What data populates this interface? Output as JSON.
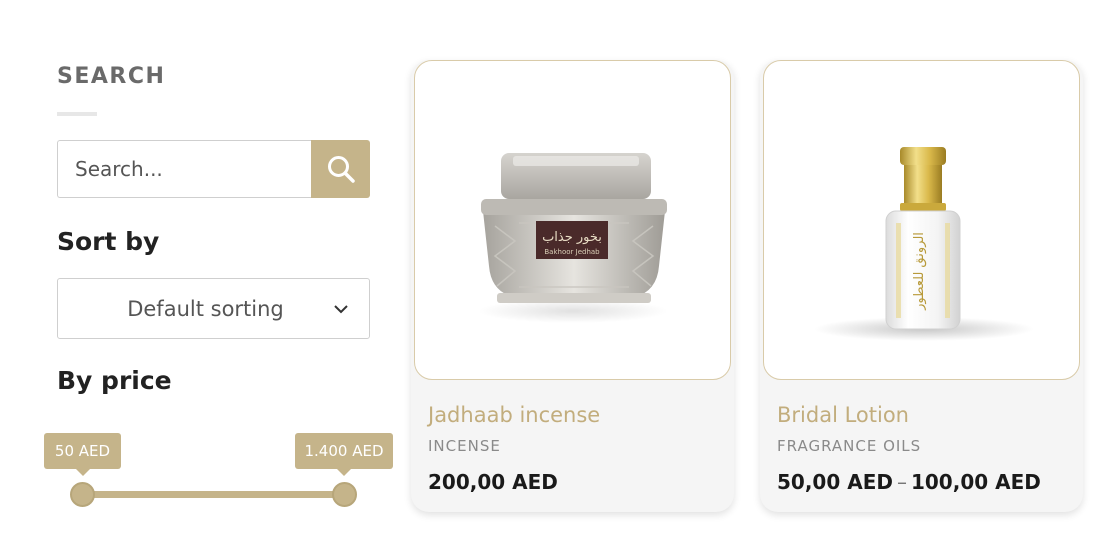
{
  "sidebar": {
    "search": {
      "title": "SEARCH",
      "placeholder": "Search..."
    },
    "sort": {
      "title": "Sort by",
      "selected": "Default sorting"
    },
    "price_filter": {
      "title": "By price",
      "min_label": "50 AED",
      "max_label": "1.400 AED",
      "selected_range_fraction": [
        0.0,
        1.0
      ]
    }
  },
  "products": [
    {
      "name": "Jadhaab incense",
      "category": "INCENSE",
      "price": "200,00 AED",
      "image_label_arabic": "بخور جذاب",
      "image_label_latin": "Bakhoor Jedhab"
    },
    {
      "name": "Bridal Lotion",
      "category": "FRAGRANCE OILS",
      "price_from": "50,00 AED",
      "price_separator": "–",
      "price_to": "100,00 AED",
      "image_label_arabic": "الرونق للعطور"
    }
  ],
  "colors": {
    "accent": "#c5b48a",
    "product_name": "#c2ad7d",
    "card_background": "#f5f5f5"
  },
  "icons": {
    "search_button": "search-icon",
    "sort_dropdown": "chevron-down-icon"
  }
}
